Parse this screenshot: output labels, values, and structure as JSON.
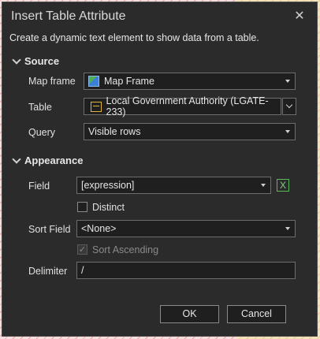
{
  "dialog": {
    "title": "Insert Table Attribute",
    "description": "Create a dynamic text element to show data from a table."
  },
  "source": {
    "heading": "Source",
    "map_frame": {
      "label": "Map frame",
      "value": "Map Frame"
    },
    "table": {
      "label": "Table",
      "value": "Local Government Authority (LGATE-233)"
    },
    "query": {
      "label": "Query",
      "value": "Visible rows"
    }
  },
  "appearance": {
    "heading": "Appearance",
    "field": {
      "label": "Field",
      "value": "[expression]",
      "expression_icon": "x-expression-icon"
    },
    "distinct": {
      "label": "Distinct",
      "checked": false
    },
    "sort_field": {
      "label": "Sort Field",
      "value": "<None>"
    },
    "sort_ascending": {
      "label": "Sort Ascending",
      "checked": true,
      "disabled": true
    },
    "delimiter": {
      "label": "Delimiter",
      "value": "/"
    }
  },
  "buttons": {
    "ok": "OK",
    "cancel": "Cancel"
  },
  "colors": {
    "dialog_bg": "#2b2b2b",
    "field_bg": "#1f1f1f",
    "accent_green": "#5cb85c"
  }
}
